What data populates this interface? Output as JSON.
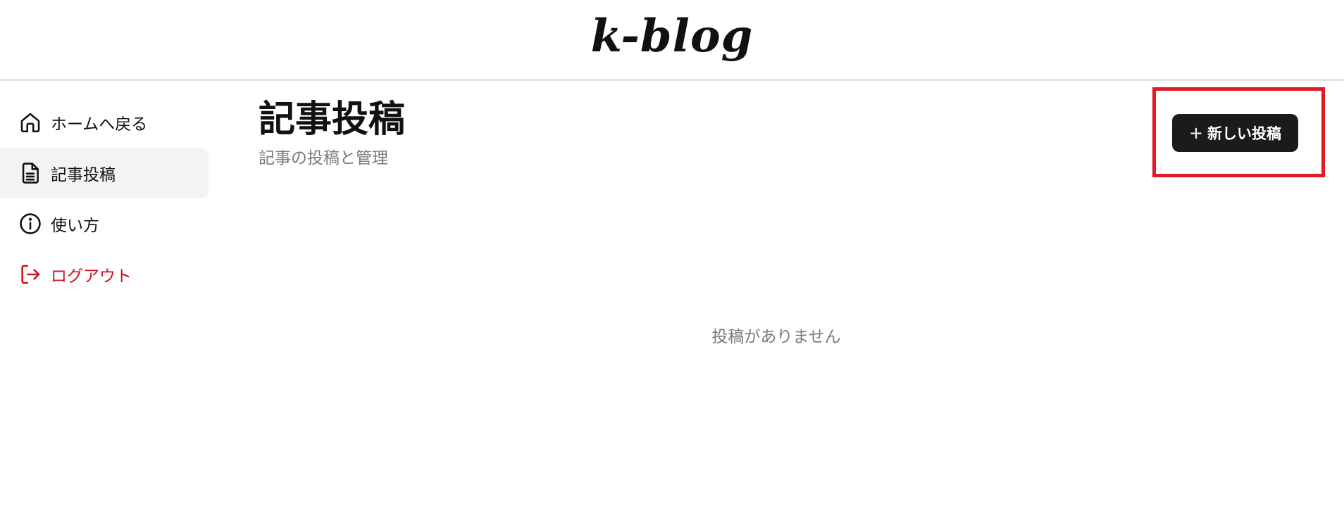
{
  "header": {
    "logo": "k-blog"
  },
  "sidebar": {
    "items": [
      {
        "label": "ホームへ戻る",
        "icon": "home-icon"
      },
      {
        "label": "記事投稿",
        "icon": "document-icon",
        "active": true
      },
      {
        "label": "使い方",
        "icon": "info-icon"
      },
      {
        "label": "ログアウト",
        "icon": "logout-icon",
        "color": "#d0101c"
      }
    ]
  },
  "main": {
    "title": "記事投稿",
    "subtitle": "記事の投稿と管理",
    "new_post_plus": "+",
    "new_post_label": "新しい投稿",
    "empty_message": "投稿がありません"
  },
  "colors": {
    "accent": "#1b1b1b",
    "danger": "#d0101c",
    "highlight": "#e01b24"
  }
}
